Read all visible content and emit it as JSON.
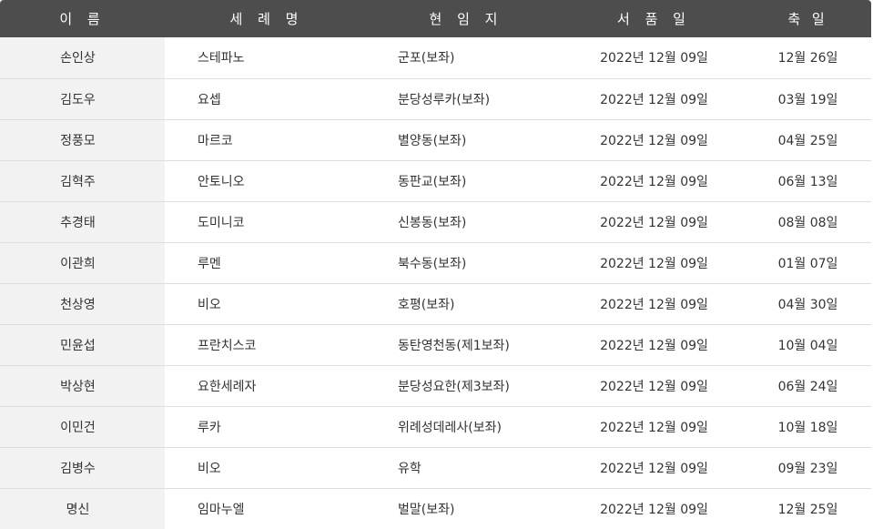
{
  "table": {
    "headers": {
      "name": "이 름",
      "baptism": "세 례 명",
      "post": "현 임 지",
      "ordination": "서 품 일",
      "feast": "축 일"
    },
    "rows": [
      {
        "name": "손인상",
        "baptism": "스테파노",
        "post": "군포(보좌)",
        "ordination": "2022년 12월 09일",
        "feast": "12월 26일"
      },
      {
        "name": "김도우",
        "baptism": "요셉",
        "post": "분당성루카(보좌)",
        "ordination": "2022년 12월 09일",
        "feast": "03월 19일"
      },
      {
        "name": "정풍모",
        "baptism": "마르코",
        "post": "별양동(보좌)",
        "ordination": "2022년 12월 09일",
        "feast": "04월 25일"
      },
      {
        "name": "김혁주",
        "baptism": "안토니오",
        "post": "동판교(보좌)",
        "ordination": "2022년 12월 09일",
        "feast": "06월 13일"
      },
      {
        "name": "추경태",
        "baptism": "도미니코",
        "post": "신봉동(보좌)",
        "ordination": "2022년 12월 09일",
        "feast": "08월 08일"
      },
      {
        "name": "이관희",
        "baptism": "루멘",
        "post": "북수동(보좌)",
        "ordination": "2022년 12월 09일",
        "feast": "01월 07일"
      },
      {
        "name": "천상영",
        "baptism": "비오",
        "post": "호평(보좌)",
        "ordination": "2022년 12월 09일",
        "feast": "04월 30일"
      },
      {
        "name": "민윤섭",
        "baptism": "프란치스코",
        "post": "동탄영천동(제1보좌)",
        "ordination": "2022년 12월 09일",
        "feast": "10월 04일"
      },
      {
        "name": "박상현",
        "baptism": "요한세례자",
        "post": "분당성요한(제3보좌)",
        "ordination": "2022년 12월 09일",
        "feast": "06월 24일"
      },
      {
        "name": "이민건",
        "baptism": "루카",
        "post": "위례성데레사(보좌)",
        "ordination": "2022년 12월 09일",
        "feast": "10월 18일"
      },
      {
        "name": "김병수",
        "baptism": "비오",
        "post": "유학",
        "ordination": "2022년 12월 09일",
        "feast": "09월 23일"
      },
      {
        "name": "명신",
        "baptism": "임마누엘",
        "post": "벌말(보좌)",
        "ordination": "2022년 12월 09일",
        "feast": "12월 25일"
      }
    ]
  }
}
